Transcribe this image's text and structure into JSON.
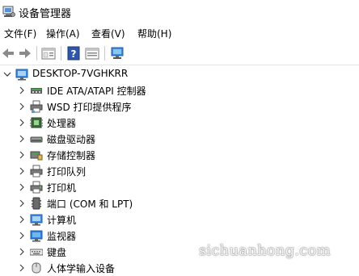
{
  "window": {
    "title": "设备管理器"
  },
  "menu": [
    "文件(F)",
    "操作(A)",
    "查看(V)",
    "帮助(H)"
  ],
  "toolbar": [
    "back-icon",
    "forward-icon",
    "properties-icon",
    "help-icon",
    "view-icon",
    "monitor-icon"
  ],
  "tree": {
    "root": "DESKTOP-7VGHKRR",
    "items": [
      {
        "label": "IDE ATA/ATAPI 控制器",
        "icon": "ide-controller-icon"
      },
      {
        "label": "WSD 打印提供程序",
        "icon": "wsd-printer-icon"
      },
      {
        "label": "处理器",
        "icon": "processor-icon"
      },
      {
        "label": "磁盘驱动器",
        "icon": "disk-drive-icon"
      },
      {
        "label": "存储控制器",
        "icon": "storage-controller-icon"
      },
      {
        "label": "打印队列",
        "icon": "print-queue-icon"
      },
      {
        "label": "打印机",
        "icon": "printer-icon"
      },
      {
        "label": "端口 (COM 和 LPT)",
        "icon": "port-icon"
      },
      {
        "label": "计算机",
        "icon": "computer-icon"
      },
      {
        "label": "监视器",
        "icon": "monitor-icon"
      },
      {
        "label": "键盘",
        "icon": "keyboard-icon"
      },
      {
        "label": "人体学输入设备",
        "icon": "hid-icon"
      }
    ]
  },
  "watermark": "sichuanhong.com"
}
